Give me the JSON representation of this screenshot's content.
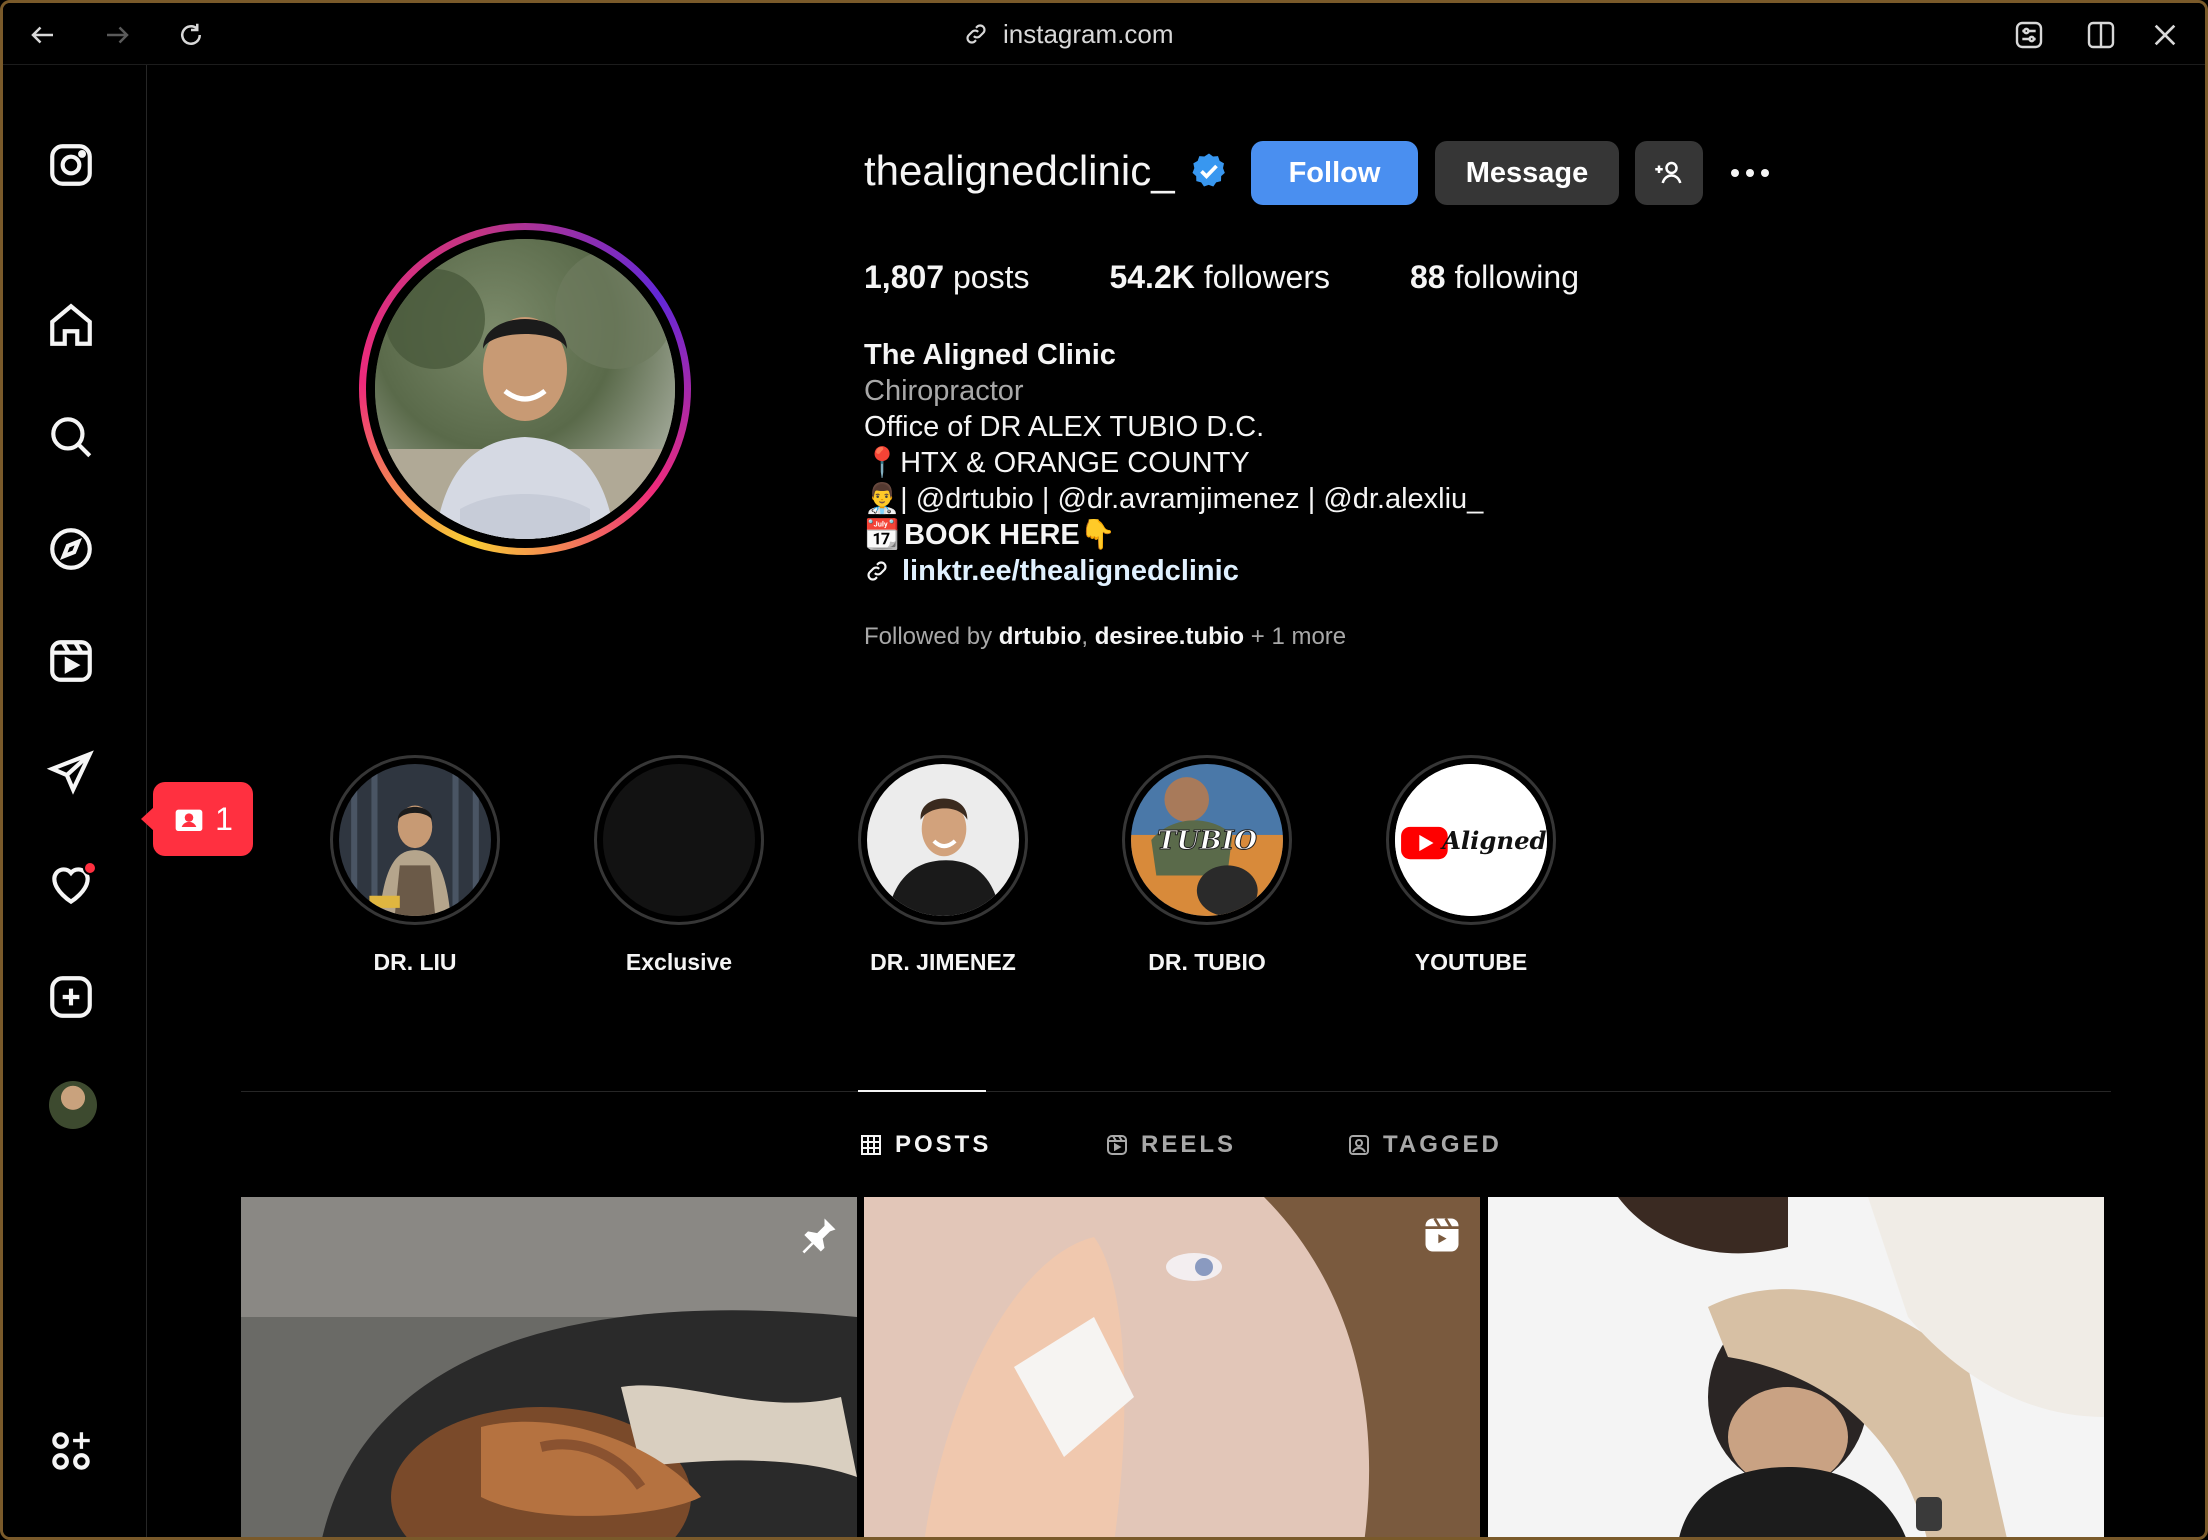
{
  "browser": {
    "url": "instagram.com"
  },
  "sidebar": {
    "notification_count": "1"
  },
  "profile": {
    "username": "thealignedclinic_",
    "follow_label": "Follow",
    "message_label": "Message",
    "stats": {
      "posts_count": "1,807",
      "posts_label": "posts",
      "followers_count": "54.2K",
      "followers_label": "followers",
      "following_count": "88",
      "following_label": "following"
    },
    "bio": {
      "name": "The Aligned Clinic",
      "category": "Chiropractor",
      "line1": "Office of DR ALEX TUBIO D.C.",
      "line2": "📍HTX & ORANGE COUNTY",
      "line3": "👨‍⚕️| @drtubio | @dr.avramjimenez | @dr.alexliu_",
      "line4_emoji": "📆",
      "line4_text": "BOOK HERE👇",
      "link": "linktr.ee/thealignedclinic"
    },
    "followed_by": {
      "prefix": "Followed by",
      "user1": "drtubio",
      "separator": ",",
      "user2": "desiree.tubio",
      "suffix": "+ 1 more"
    }
  },
  "highlights": [
    {
      "label": "DR. LIU"
    },
    {
      "label": "Exclusive"
    },
    {
      "label": "DR. JIMENEZ"
    },
    {
      "label": "DR. TUBIO",
      "overlay": "TUBIO"
    },
    {
      "label": "YOUTUBE",
      "overlay": "Aligned"
    }
  ],
  "tabs": {
    "posts": "POSTS",
    "reels": "REELS",
    "tagged": "TAGGED"
  },
  "colors": {
    "accent": "#4a8ff0",
    "verified": "#3897f0",
    "notification": "#ff3040"
  }
}
